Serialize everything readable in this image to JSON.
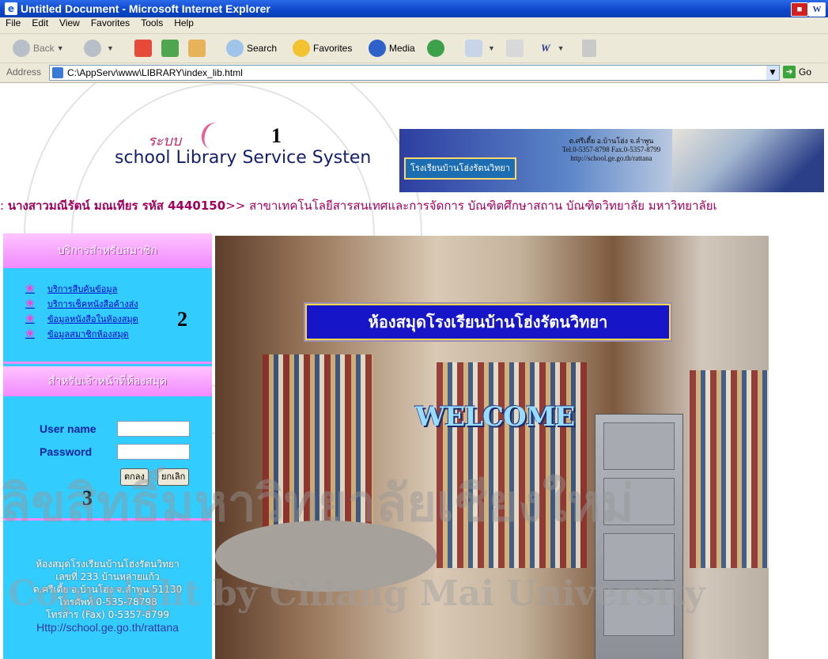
{
  "window": {
    "title": "Untitled Document - Microsoft Internet Explorer",
    "controls": [
      "W"
    ]
  },
  "menubar": [
    "File",
    "Edit",
    "View",
    "Favorites",
    "Tools",
    "Help"
  ],
  "toolbar": {
    "back": "Back",
    "search": "Search",
    "favorites": "Favorites",
    "media": "Media"
  },
  "address": {
    "label": "Address",
    "url": "C:\\AppServ\\www\\LIBRARY\\index_lib.html",
    "go": "Go"
  },
  "annotations": [
    "1",
    "2",
    "3"
  ],
  "header": {
    "logo_thai": "ระบบ",
    "logo_en": "school Library Service Systen",
    "banner_sign": "โรงเรียนบ้านโฮ่งรัตนวิทยา",
    "banner_address": [
      "ต.ศรีเตี้ย อ.บ้านโฮ่ง จ.ลำพูน",
      "Tel.0-5357-8798 Fax.0-5357-8799",
      "http://school.ge.go.th/rattana"
    ]
  },
  "marquee": {
    "prefix": ": ",
    "name": "นางสาวมณีรัตน์  มณเทียร  รหัส 4440150",
    "rest": ">> สาขาเทคโนโลยีสารสนเทศและการจัดการ  บัณฑิตศึกษาสถาน บัณฑิตวิทยาลัย  มหาวิทยาลัยเ"
  },
  "sidebar": {
    "member_header": "บริการสำหรับสมาชิก",
    "member_items": [
      {
        "label": "บริการสืบค้นข้อมูล"
      },
      {
        "label": "บริการเช็คหนังสือค้างส่ง"
      },
      {
        "label": "ข้อมูลหนังสือในห้องสมุด"
      },
      {
        "label": "ข้อมูลสมาชิกห้องสมุด"
      }
    ],
    "staff_header": "สำหรับเจ้าหน้าที่ห้องสมุด",
    "username_label": "User name",
    "password_label": "Password",
    "username_value": "",
    "password_value": "",
    "ok_button": "ตกลง",
    "cancel_button": "ยกเลิก",
    "footer_lines": [
      "ห้องสมุดโรงเรียนบ้านโฮ่งรัตนวิทยา",
      "เลขที่ 233 บ้านหล่ายแก้ว",
      "ต.ศรีเตี้ย อ.บ้านโฮ่ง จ.ลำพูน 51130",
      "โทรศัพท์ 0-535-78798",
      "โทรสาร (Fax) 0-5357-8799"
    ],
    "footer_url": "Http://school.ge.go.th/rattana"
  },
  "main": {
    "sign": "ห้องสมุดโรงเรียนบ้านโฮ่งรัตนวิทยา",
    "welcome": "WELCOME"
  },
  "watermark": {
    "line1": "ลิขสิทธิ์มหาวิทยาลัยเชียงใหม่",
    "line2": "Copyright by Chiang Mai University"
  }
}
